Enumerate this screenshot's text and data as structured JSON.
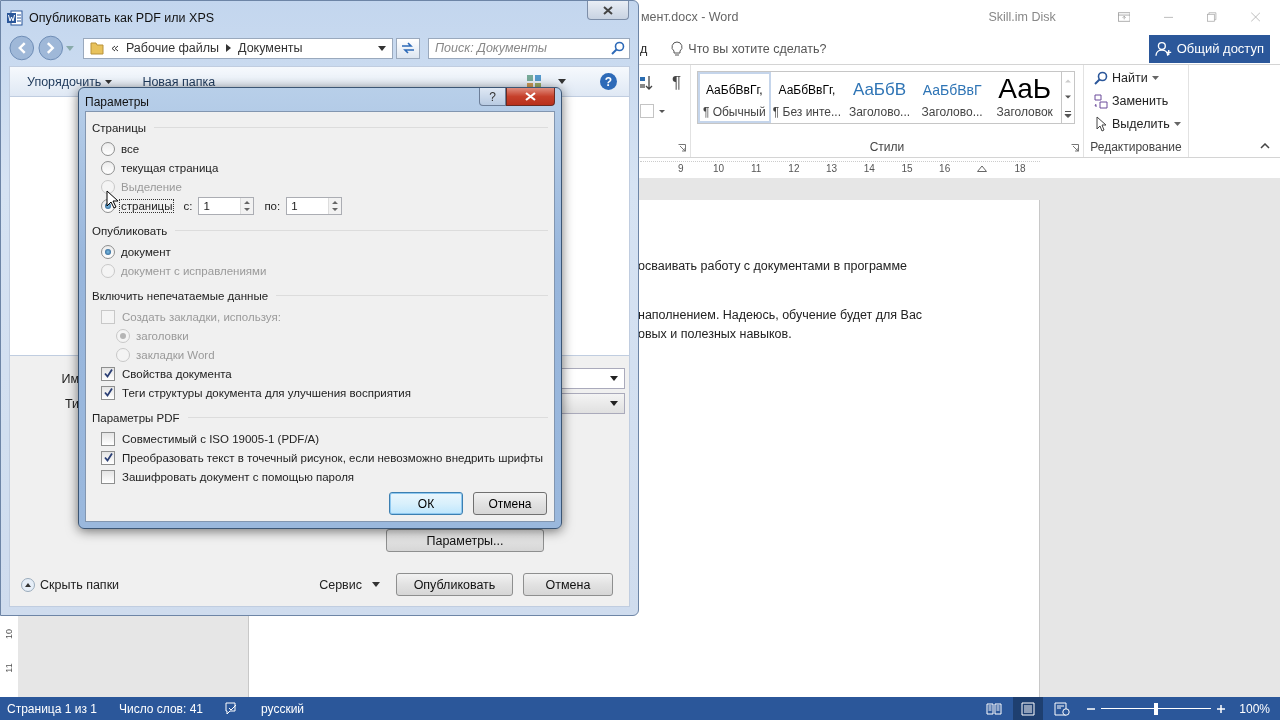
{
  "word": {
    "title": "мент.docx - Word",
    "account": "Skill.im Disk",
    "tab_fragment": "д",
    "tell_me": "Что вы хотите сделать?",
    "share": "Общий доступ",
    "marks_glyph": "¶",
    "styles": [
      {
        "preview": "АаБбВвГг,",
        "name": "¶ Обычный",
        "kind": "normal",
        "selected": true
      },
      {
        "preview": "АаБбВвГг,",
        "name": "¶ Без инте...",
        "kind": "normal",
        "selected": false
      },
      {
        "preview": "АаБбВ",
        "name": "Заголово...",
        "kind": "heading1",
        "selected": false
      },
      {
        "preview": "АаБбВвГ",
        "name": "Заголово...",
        "kind": "heading2",
        "selected": false
      },
      {
        "preview": "АаЬ",
        "name": "Заголовок",
        "kind": "title",
        "selected": false
      }
    ],
    "editing": [
      {
        "label": "Найти",
        "kind": "find",
        "dropdown": true
      },
      {
        "label": "Заменить",
        "kind": "replace",
        "dropdown": false
      },
      {
        "label": "Выделить",
        "kind": "select",
        "dropdown": true
      }
    ],
    "group_labels": [
      "Стили",
      "Редактирование"
    ],
    "ruler": [
      {
        "kind": "number",
        "label": "9"
      },
      {
        "kind": "number",
        "label": "10"
      },
      {
        "kind": "number",
        "label": "11"
      },
      {
        "kind": "number",
        "label": "12"
      },
      {
        "kind": "number",
        "label": "13"
      },
      {
        "kind": "number",
        "label": "14"
      },
      {
        "kind": "number",
        "label": "15"
      },
      {
        "kind": "number",
        "label": "16"
      },
      {
        "kind": "indent"
      },
      {
        "kind": "number",
        "label": "18"
      }
    ],
    "vertical_ruler": [
      "10",
      "11"
    ],
    "document_paragraphs": [
      [
        "осваивать работу с документами в программе"
      ],
      [
        "наполнением. Надеюсь, обучение будет для Вас",
        "овых и полезных навыков."
      ]
    ],
    "status": {
      "page": "Страница 1 из 1",
      "words": "Число слов: 41",
      "language": "русский",
      "zoom": "100%",
      "level": 0.5,
      "views": [
        {
          "kind": "read",
          "selected": false
        },
        {
          "kind": "print",
          "selected": true
        },
        {
          "kind": "web",
          "selected": false
        }
      ]
    }
  },
  "save_dialog": {
    "title": "Опубликовать как PDF или XPS",
    "path": [
      "Рабочие файлы",
      "Документы"
    ],
    "search_placeholder": "Поиск: Документы",
    "toolbar": [
      "Упорядочить",
      "Новая папка"
    ],
    "help_glyph": "?",
    "field_labels": [
      "Им",
      "Ти"
    ],
    "options_button": "Параметры...",
    "hide_folders": "Скрыть папки",
    "service": "Сервис",
    "buttons": [
      "Опубликовать",
      "Отмена"
    ]
  },
  "params": {
    "title": "Параметры",
    "help": "?",
    "sections": [
      {
        "title": "Страницы",
        "items": [
          {
            "kind": "radio",
            "label": "все",
            "selected": false,
            "disabled": false
          },
          {
            "kind": "radio",
            "label": "текущая страница",
            "selected": false,
            "disabled": false
          },
          {
            "kind": "radio",
            "label": "Выделение",
            "selected": false,
            "disabled": true
          },
          {
            "kind": "range",
            "label": "страницы",
            "selected": true,
            "disabled": false,
            "focused": true,
            "from_label": "с:",
            "from": "1",
            "to_label": "по:",
            "to": "1"
          }
        ]
      },
      {
        "title": "Опубликовать",
        "items": [
          {
            "kind": "radio",
            "label": "документ",
            "selected": true,
            "disabled": false
          },
          {
            "kind": "radio",
            "label": "документ с исправлениями",
            "selected": false,
            "disabled": true
          }
        ]
      },
      {
        "title": "Включить непечатаемые данные",
        "items": [
          {
            "kind": "checkbox",
            "label": "Создать закладки, используя:",
            "checked": false,
            "disabled": true,
            "children": [
              {
                "kind": "radio",
                "label": "заголовки",
                "selected": true,
                "disabled": true
              },
              {
                "kind": "radio",
                "label": "закладки Word",
                "selected": false,
                "disabled": true
              }
            ]
          },
          {
            "kind": "checkbox",
            "label": "Свойства документа",
            "checked": true,
            "disabled": false
          },
          {
            "kind": "checkbox",
            "label": "Теги структуры документа для улучшения восприятия",
            "checked": true,
            "disabled": false
          }
        ]
      },
      {
        "title": "Параметры PDF",
        "items": [
          {
            "kind": "checkbox",
            "label": "Совместимый с ISO 19005-1 (PDF/A)",
            "checked": false,
            "disabled": false
          },
          {
            "kind": "checkbox",
            "label": "Преобразовать текст в точечный рисунок, если невозможно внедрить шрифты",
            "checked": true,
            "disabled": false
          },
          {
            "kind": "checkbox",
            "label": "Зашифровать документ с помощью пароля",
            "checked": false,
            "disabled": false
          }
        ]
      }
    ],
    "buttons": [
      {
        "label": "ОК",
        "default": true
      },
      {
        "label": "Отмена",
        "default": false
      }
    ]
  }
}
